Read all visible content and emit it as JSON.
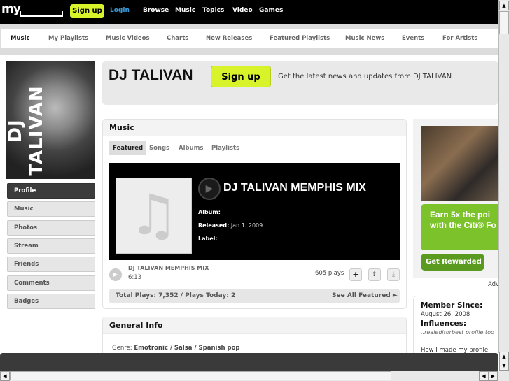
{
  "topbar": {
    "logo": "my",
    "signup": "Sign up",
    "login": "Login",
    "nav": [
      "Browse",
      "Music",
      "Topics",
      "Video",
      "Games"
    ]
  },
  "subnav": [
    "Music",
    "My Playlists",
    "Music Videos",
    "Charts",
    "New Releases",
    "Featured Playlists",
    "Music News",
    "Events",
    "For Artists"
  ],
  "profile": {
    "photo_text": "DJ TALIVAN",
    "nav": [
      "Profile",
      "Music",
      "Photos",
      "Stream",
      "Friends",
      "Comments",
      "Badges"
    ],
    "active": "Profile"
  },
  "header": {
    "artist": "DJ TALIVAN",
    "signup": "Sign up",
    "tagline": "Get the latest news and updates from DJ TALIVAN"
  },
  "music": {
    "title": "Music",
    "tabs": [
      "Featured",
      "Songs",
      "Albums",
      "Playlists"
    ],
    "active_tab": "Featured",
    "featured": {
      "label": "",
      "title": "DJ TALIVAN MEMPHIS MIX",
      "album_label": "Album:",
      "album": "",
      "released_label": "Released:",
      "released": "Jan 1. 2009",
      "label_label": "Label:"
    },
    "track": {
      "name": "DJ TALIVAN MEMPHIS MIX",
      "duration": "6:13",
      "plays": "605 plays"
    },
    "totals": "Total Plays: 7,352 / Plays Today: 2",
    "see_all": "See All Featured ►"
  },
  "general": {
    "title": "General Info",
    "genre_label": "Genre:",
    "genre": "Emotronic / Salsa / Spanish pop"
  },
  "ad": {
    "text1": "Earn 5x the poi",
    "text2": "with the Citi® Fo",
    "button": "Get Rewarded ▸",
    "label": "Adv"
  },
  "member": {
    "since_label": "Member Since:",
    "since": "August 26, 2008",
    "influences_label": "Influences:",
    "influences": "..realeditorbest profile too",
    "howto": "How I made my profile:"
  }
}
